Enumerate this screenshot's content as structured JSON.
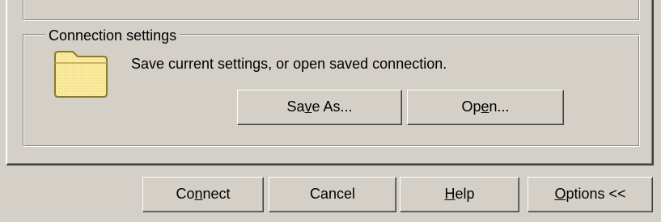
{
  "connection_group": {
    "title": "Connection settings",
    "description": "Save current settings, or open saved connection.",
    "icon": "folder-icon",
    "save_as": {
      "pre": "Sa",
      "accel": "v",
      "post": "e As..."
    },
    "open": {
      "pre": "Op",
      "accel": "e",
      "post": "n..."
    }
  },
  "dialog_buttons": {
    "connect": {
      "pre": "Co",
      "accel": "n",
      "post": "nect"
    },
    "cancel": {
      "pre": "Cancel",
      "accel": "",
      "post": ""
    },
    "help": {
      "pre": "",
      "accel": "H",
      "post": "elp"
    },
    "options": {
      "pre": "",
      "accel": "O",
      "post": "ptions <<"
    }
  },
  "colors": {
    "face": "#d4d0c8",
    "highlight": "#ffffff",
    "shadow": "#808080",
    "dark_shadow": "#404040",
    "folder_fill": "#f5e38c",
    "folder_edge": "#8a7a2a"
  }
}
